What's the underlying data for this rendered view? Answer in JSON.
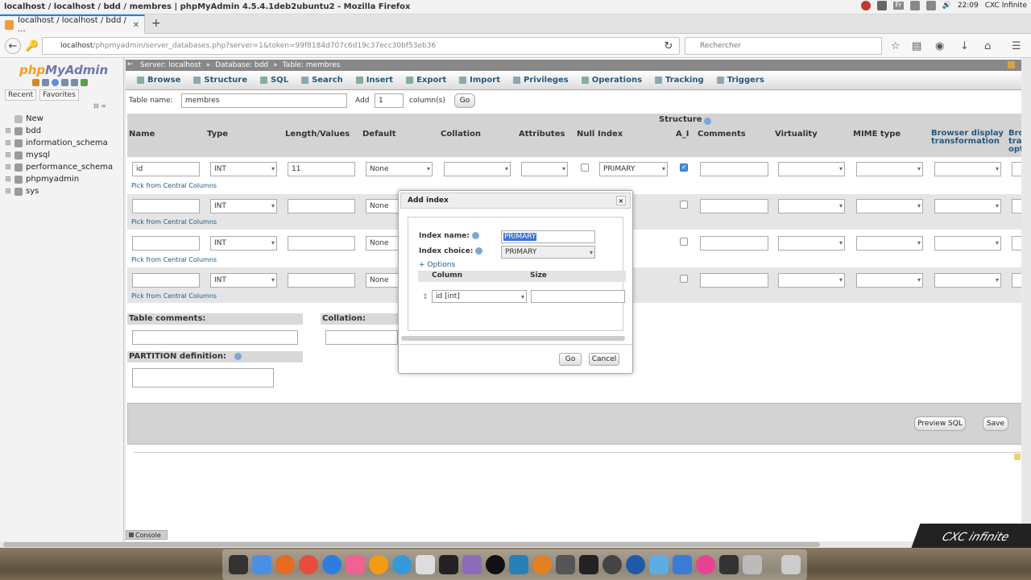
{
  "window": {
    "title": "localhost / localhost / bdd / membres | phpMyAdmin 4.5.4.1deb2ubuntu2 - Mozilla Firefox"
  },
  "systray": {
    "lang": "Fr",
    "time": "22:09",
    "user": "CXC Infinite"
  },
  "browser": {
    "tab_title": "localhost / localhost / bdd / ...",
    "url_host": "localhost",
    "url_rest": "/phpmyadmin/server_databases.php?server=1&token=99f8184d707c6d19c37ecc30bf53eb36",
    "search_placeholder": "Rechercher"
  },
  "sidebar": {
    "logo_php": "php",
    "logo_my": "MyAdmin",
    "recent": "Recent",
    "favorites": "Favorites",
    "items": [
      "New",
      "bdd",
      "information_schema",
      "mysql",
      "performance_schema",
      "phpmyadmin",
      "sys"
    ]
  },
  "breadcrumb": {
    "server": "Server: localhost",
    "database": "Database: bdd",
    "table": "Table: membres"
  },
  "tabs": [
    "Browse",
    "Structure",
    "SQL",
    "Search",
    "Insert",
    "Export",
    "Import",
    "Privileges",
    "Operations",
    "Tracking",
    "Triggers"
  ],
  "form": {
    "table_name_label": "Table name:",
    "table_name": "membres",
    "add_label": "Add",
    "add_count": "1",
    "columns_label": "column(s)",
    "go": "Go"
  },
  "structure": {
    "title": "Structure",
    "headers": [
      "Name",
      "Type",
      "Length/Values",
      "Default",
      "Collation",
      "Attributes",
      "Null",
      "Index",
      "A_I",
      "Comments",
      "Virtuality",
      "MIME type",
      "Browser display transformation",
      "Brows transf optio"
    ],
    "pick_label": "Pick from Central Columns",
    "rows": [
      {
        "name": "id",
        "type": "INT",
        "length": "11",
        "default": "None",
        "index": "PRIMARY",
        "ai": true
      },
      {
        "name": "",
        "type": "INT",
        "length": "",
        "default": "None",
        "index": "",
        "ai": false
      },
      {
        "name": "",
        "type": "INT",
        "length": "",
        "default": "None",
        "index": "",
        "ai": false
      },
      {
        "name": "",
        "type": "INT",
        "length": "",
        "default": "None",
        "index": "",
        "ai": false
      }
    ]
  },
  "table_comments_label": "Table comments:",
  "collation_label": "Collation:",
  "partition_label": "PARTITION definition:",
  "footer": {
    "preview_sql": "Preview SQL",
    "save": "Save"
  },
  "console": "Console",
  "dialog": {
    "title": "Add index",
    "close": "×",
    "index_name_label": "Index name:",
    "index_name": "PRIMARY",
    "index_choice_label": "Index choice:",
    "index_choice": "PRIMARY",
    "options": "+ Options",
    "col_header": "Column",
    "size_header": "Size",
    "column_value": "id [int]",
    "go": "Go",
    "cancel": "Cancel"
  },
  "watermark": "CXC infinite",
  "colors": {
    "accent": "#235a81",
    "logo_blue": "#6c78af",
    "logo_orange": "#f89d1f",
    "header_gray": "#d3d3d3"
  }
}
